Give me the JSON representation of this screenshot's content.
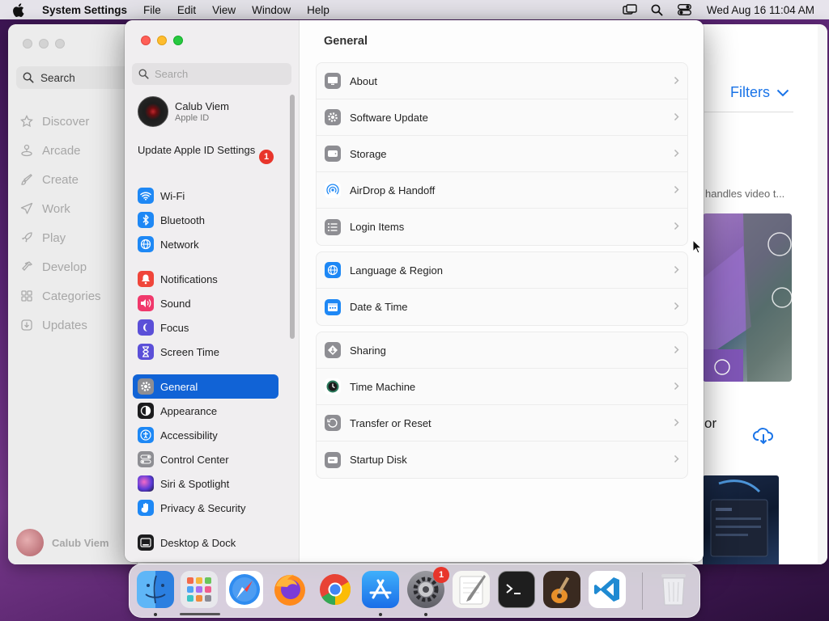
{
  "menubar": {
    "app_name": "System Settings",
    "menus": [
      "File",
      "Edit",
      "View",
      "Window",
      "Help"
    ],
    "clock": "Wed Aug 16  11:04 AM"
  },
  "appstore": {
    "search_label": "Search",
    "nav": [
      "Discover",
      "Arcade",
      "Create",
      "Work",
      "Play",
      "Develop",
      "Categories",
      "Updates"
    ],
    "user_name": "Calub Viem",
    "filters_label": "Filters",
    "snippet": "handles video t...",
    "heading_fragment": "or"
  },
  "settings": {
    "search_placeholder": "Search",
    "profile": {
      "name": "Calub Viem",
      "subtitle": "Apple ID"
    },
    "update_label": "Update Apple ID Settings",
    "update_badge": "1",
    "sidebar": [
      {
        "label": "Wi-Fi",
        "icon": "wifi-icon",
        "color": "#1e88f5"
      },
      {
        "label": "Bluetooth",
        "icon": "bluetooth-icon",
        "color": "#1e88f5"
      },
      {
        "label": "Network",
        "icon": "globe-icon",
        "color": "#1e88f5"
      },
      {
        "label": "Notifications",
        "icon": "bell-icon",
        "color": "#f0453a"
      },
      {
        "label": "Sound",
        "icon": "speaker-icon",
        "color": "#f0386b"
      },
      {
        "label": "Focus",
        "icon": "moon-icon",
        "color": "#5b4fd8"
      },
      {
        "label": "Screen Time",
        "icon": "hourglass-icon",
        "color": "#5b4fd8"
      },
      {
        "label": "General",
        "icon": "gear-icon",
        "color": "#8e8e93"
      },
      {
        "label": "Appearance",
        "icon": "appearance-icon",
        "color": "#1c1c1e"
      },
      {
        "label": "Accessibility",
        "icon": "accessibility-icon",
        "color": "#1e88f5"
      },
      {
        "label": "Control Center",
        "icon": "toggles-icon",
        "color": "#8e8e93"
      },
      {
        "label": "Siri & Spotlight",
        "icon": "siri-icon",
        "color": "#6a3cc8"
      },
      {
        "label": "Privacy & Security",
        "icon": "hand-icon",
        "color": "#1e88f5"
      },
      {
        "label": "Desktop & Dock",
        "icon": "dock-icon",
        "color": "#1c1c1e"
      }
    ],
    "active_item": "General",
    "main_title": "General",
    "groups": [
      [
        {
          "label": "About",
          "icon": "display-icon"
        },
        {
          "label": "Software Update",
          "icon": "gear-badge-icon"
        },
        {
          "label": "Storage",
          "icon": "drive-icon"
        },
        {
          "label": "AirDrop & Handoff",
          "icon": "airdrop-icon"
        },
        {
          "label": "Login Items",
          "icon": "list-icon"
        }
      ],
      [
        {
          "label": "Language & Region",
          "icon": "globe-icon"
        },
        {
          "label": "Date & Time",
          "icon": "calendar-icon"
        }
      ],
      [
        {
          "label": "Sharing",
          "icon": "sharing-icon"
        },
        {
          "label": "Time Machine",
          "icon": "time-machine-icon"
        },
        {
          "label": "Transfer or Reset",
          "icon": "reset-icon"
        },
        {
          "label": "Startup Disk",
          "icon": "disk-icon"
        }
      ]
    ]
  },
  "dock": {
    "apps": [
      "Finder",
      "Launchpad",
      "Safari",
      "Firefox",
      "Chrome",
      "App Store",
      "System Settings",
      "TextEdit",
      "Terminal",
      "GarageBand",
      "Visual Studio Code",
      "Trash"
    ],
    "settings_badge": "1"
  }
}
